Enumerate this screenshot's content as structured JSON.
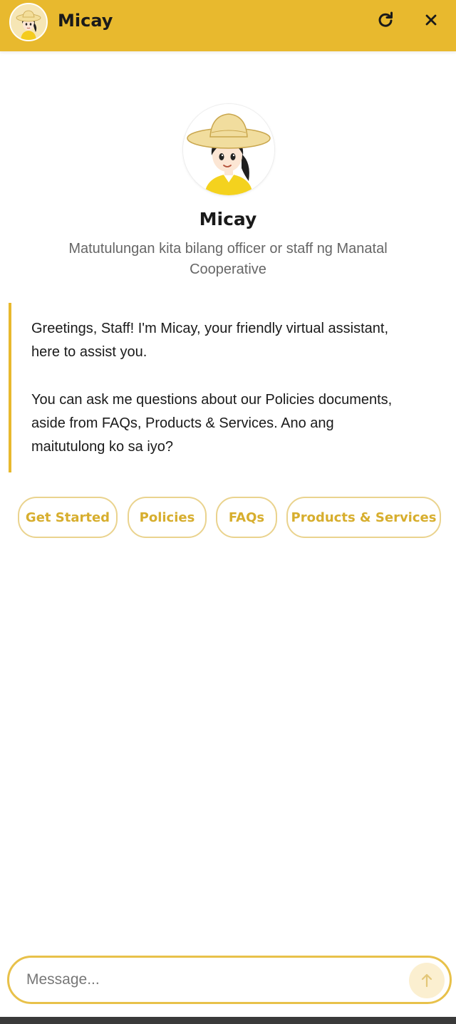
{
  "header": {
    "title": "Micay",
    "avatar_icon": "micay-avatar-icon",
    "refresh_icon": "refresh-icon",
    "close_icon": "close-icon",
    "background_color": "#E8B92E"
  },
  "profile": {
    "name": "Micay",
    "description": "Matutulungan kita bilang officer or staff ng Manatal Cooperative",
    "avatar_icon": "micay-avatar-icon"
  },
  "greeting": {
    "paragraph1": "Greetings, Staff! I'm Micay, your friendly virtual assistant, here to assist you.",
    "paragraph2": "You can ask me questions about our Policies documents, aside from FAQs, Products & Services. Ano ang maitutulong ko sa iyo?"
  },
  "quick_replies": [
    {
      "label": "Get Started"
    },
    {
      "label": "Policies"
    },
    {
      "label": "FAQs"
    },
    {
      "label": "Products & Services"
    }
  ],
  "composer": {
    "placeholder": "Message...",
    "send_icon": "arrow-up-icon"
  },
  "colors": {
    "accent": "#E8B92E",
    "chip_text": "#D7AE2E"
  }
}
